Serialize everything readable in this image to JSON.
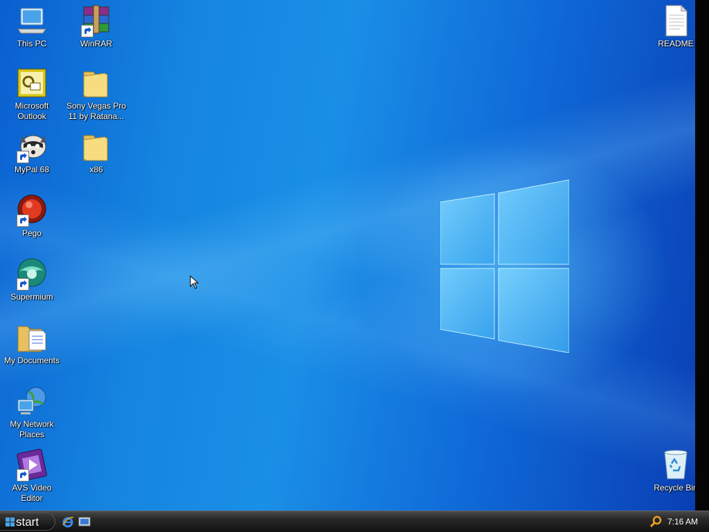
{
  "desktop": {
    "icons": [
      {
        "label": "This PC",
        "icon": "computer-icon"
      },
      {
        "label": "WinRAR",
        "icon": "winrar-icon",
        "shortcut": true
      },
      {
        "label": "README",
        "icon": "text-document-icon"
      },
      {
        "label": "Microsoft Outlook",
        "icon": "outlook-icon"
      },
      {
        "label": "Sony Vegas Pro 11 by Ratana...",
        "icon": "folder-icon"
      },
      {
        "label": "MyPal 68",
        "icon": "mypal-raccoon-icon",
        "shortcut": true
      },
      {
        "label": "x86",
        "icon": "folder-icon"
      },
      {
        "label": "Pego",
        "icon": "pego-icon",
        "shortcut": true
      },
      {
        "label": "Supermium",
        "icon": "supermium-icon",
        "shortcut": true
      },
      {
        "label": "My Documents",
        "icon": "my-documents-icon"
      },
      {
        "label": "My Network Places",
        "icon": "network-places-icon"
      },
      {
        "label": "AVS Video Editor",
        "icon": "avs-video-editor-icon",
        "shortcut": true
      },
      {
        "label": "Recycle Bin",
        "icon": "recycle-bin-icon"
      }
    ]
  },
  "taskbar": {
    "start_label": "start",
    "quick_launch": [
      "internet-explorer-icon",
      "show-desktop-icon"
    ],
    "tray": {
      "search_icon": "search-icon",
      "clock": "7:16 AM"
    }
  },
  "colors": {
    "wallpaper": "#1585e0",
    "taskbar": "#1a1a1a",
    "label_text": "#ffffff"
  }
}
